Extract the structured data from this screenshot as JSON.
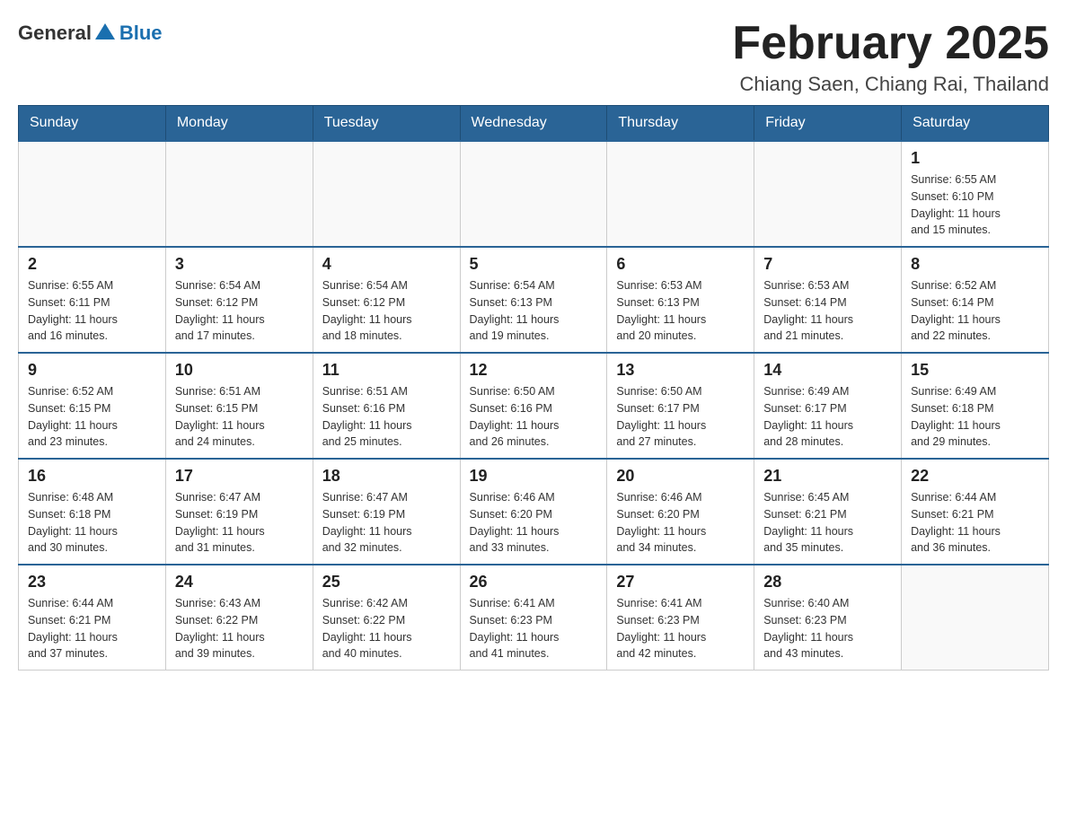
{
  "header": {
    "logo": {
      "general": "General",
      "blue": "Blue"
    },
    "title": "February 2025",
    "subtitle": "Chiang Saen, Chiang Rai, Thailand"
  },
  "days_of_week": [
    "Sunday",
    "Monday",
    "Tuesday",
    "Wednesday",
    "Thursday",
    "Friday",
    "Saturday"
  ],
  "weeks": [
    {
      "days": [
        {
          "number": "",
          "info": ""
        },
        {
          "number": "",
          "info": ""
        },
        {
          "number": "",
          "info": ""
        },
        {
          "number": "",
          "info": ""
        },
        {
          "number": "",
          "info": ""
        },
        {
          "number": "",
          "info": ""
        },
        {
          "number": "1",
          "info": "Sunrise: 6:55 AM\nSunset: 6:10 PM\nDaylight: 11 hours\nand 15 minutes."
        }
      ]
    },
    {
      "days": [
        {
          "number": "2",
          "info": "Sunrise: 6:55 AM\nSunset: 6:11 PM\nDaylight: 11 hours\nand 16 minutes."
        },
        {
          "number": "3",
          "info": "Sunrise: 6:54 AM\nSunset: 6:12 PM\nDaylight: 11 hours\nand 17 minutes."
        },
        {
          "number": "4",
          "info": "Sunrise: 6:54 AM\nSunset: 6:12 PM\nDaylight: 11 hours\nand 18 minutes."
        },
        {
          "number": "5",
          "info": "Sunrise: 6:54 AM\nSunset: 6:13 PM\nDaylight: 11 hours\nand 19 minutes."
        },
        {
          "number": "6",
          "info": "Sunrise: 6:53 AM\nSunset: 6:13 PM\nDaylight: 11 hours\nand 20 minutes."
        },
        {
          "number": "7",
          "info": "Sunrise: 6:53 AM\nSunset: 6:14 PM\nDaylight: 11 hours\nand 21 minutes."
        },
        {
          "number": "8",
          "info": "Sunrise: 6:52 AM\nSunset: 6:14 PM\nDaylight: 11 hours\nand 22 minutes."
        }
      ]
    },
    {
      "days": [
        {
          "number": "9",
          "info": "Sunrise: 6:52 AM\nSunset: 6:15 PM\nDaylight: 11 hours\nand 23 minutes."
        },
        {
          "number": "10",
          "info": "Sunrise: 6:51 AM\nSunset: 6:15 PM\nDaylight: 11 hours\nand 24 minutes."
        },
        {
          "number": "11",
          "info": "Sunrise: 6:51 AM\nSunset: 6:16 PM\nDaylight: 11 hours\nand 25 minutes."
        },
        {
          "number": "12",
          "info": "Sunrise: 6:50 AM\nSunset: 6:16 PM\nDaylight: 11 hours\nand 26 minutes."
        },
        {
          "number": "13",
          "info": "Sunrise: 6:50 AM\nSunset: 6:17 PM\nDaylight: 11 hours\nand 27 minutes."
        },
        {
          "number": "14",
          "info": "Sunrise: 6:49 AM\nSunset: 6:17 PM\nDaylight: 11 hours\nand 28 minutes."
        },
        {
          "number": "15",
          "info": "Sunrise: 6:49 AM\nSunset: 6:18 PM\nDaylight: 11 hours\nand 29 minutes."
        }
      ]
    },
    {
      "days": [
        {
          "number": "16",
          "info": "Sunrise: 6:48 AM\nSunset: 6:18 PM\nDaylight: 11 hours\nand 30 minutes."
        },
        {
          "number": "17",
          "info": "Sunrise: 6:47 AM\nSunset: 6:19 PM\nDaylight: 11 hours\nand 31 minutes."
        },
        {
          "number": "18",
          "info": "Sunrise: 6:47 AM\nSunset: 6:19 PM\nDaylight: 11 hours\nand 32 minutes."
        },
        {
          "number": "19",
          "info": "Sunrise: 6:46 AM\nSunset: 6:20 PM\nDaylight: 11 hours\nand 33 minutes."
        },
        {
          "number": "20",
          "info": "Sunrise: 6:46 AM\nSunset: 6:20 PM\nDaylight: 11 hours\nand 34 minutes."
        },
        {
          "number": "21",
          "info": "Sunrise: 6:45 AM\nSunset: 6:21 PM\nDaylight: 11 hours\nand 35 minutes."
        },
        {
          "number": "22",
          "info": "Sunrise: 6:44 AM\nSunset: 6:21 PM\nDaylight: 11 hours\nand 36 minutes."
        }
      ]
    },
    {
      "days": [
        {
          "number": "23",
          "info": "Sunrise: 6:44 AM\nSunset: 6:21 PM\nDaylight: 11 hours\nand 37 minutes."
        },
        {
          "number": "24",
          "info": "Sunrise: 6:43 AM\nSunset: 6:22 PM\nDaylight: 11 hours\nand 39 minutes."
        },
        {
          "number": "25",
          "info": "Sunrise: 6:42 AM\nSunset: 6:22 PM\nDaylight: 11 hours\nand 40 minutes."
        },
        {
          "number": "26",
          "info": "Sunrise: 6:41 AM\nSunset: 6:23 PM\nDaylight: 11 hours\nand 41 minutes."
        },
        {
          "number": "27",
          "info": "Sunrise: 6:41 AM\nSunset: 6:23 PM\nDaylight: 11 hours\nand 42 minutes."
        },
        {
          "number": "28",
          "info": "Sunrise: 6:40 AM\nSunset: 6:23 PM\nDaylight: 11 hours\nand 43 minutes."
        },
        {
          "number": "",
          "info": ""
        }
      ]
    }
  ]
}
